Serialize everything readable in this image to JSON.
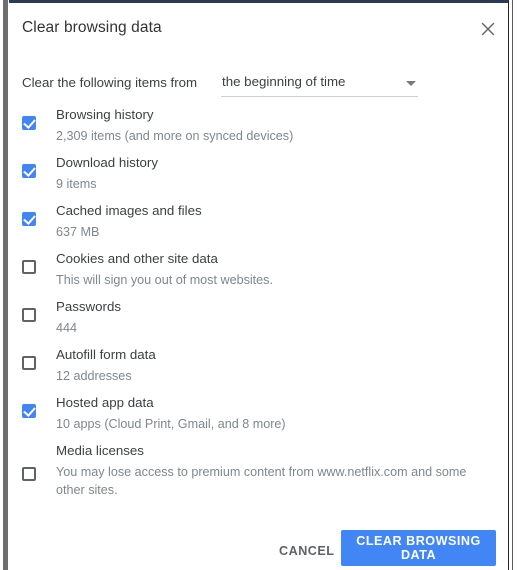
{
  "dialog": {
    "title": "Clear browsing data",
    "close_icon": "close-icon"
  },
  "range": {
    "label": "Clear the following items from",
    "selected": "the beginning of time",
    "caret_icon": "chevron-down-icon"
  },
  "options": [
    {
      "title": "Browsing history",
      "description": "2,309 items (and more on synced devices)",
      "checked": true
    },
    {
      "title": "Download history",
      "description": "9 items",
      "checked": true
    },
    {
      "title": "Cached images and files",
      "description": "637 MB",
      "checked": true
    },
    {
      "title": "Cookies and other site data",
      "description": "This will sign you out of most websites.",
      "checked": false
    },
    {
      "title": "Passwords",
      "description": "444",
      "checked": false
    },
    {
      "title": "Autofill form data",
      "description": "12 addresses",
      "checked": false
    },
    {
      "title": "Hosted app data",
      "description": "10 apps (Cloud Print, Gmail, and 8 more)",
      "checked": true
    },
    {
      "title": "Media licenses",
      "description": "You may lose access to premium content from www.netflix.com and some other sites.",
      "checked": false,
      "tall": true
    }
  ],
  "footer": {
    "cancel_label": "CANCEL",
    "confirm_label": "CLEAR BROWSING DATA"
  },
  "colors": {
    "accent": "#4285f4",
    "title_text": "#333333",
    "body_text": "#3c4043",
    "muted_text": "#80868b"
  }
}
